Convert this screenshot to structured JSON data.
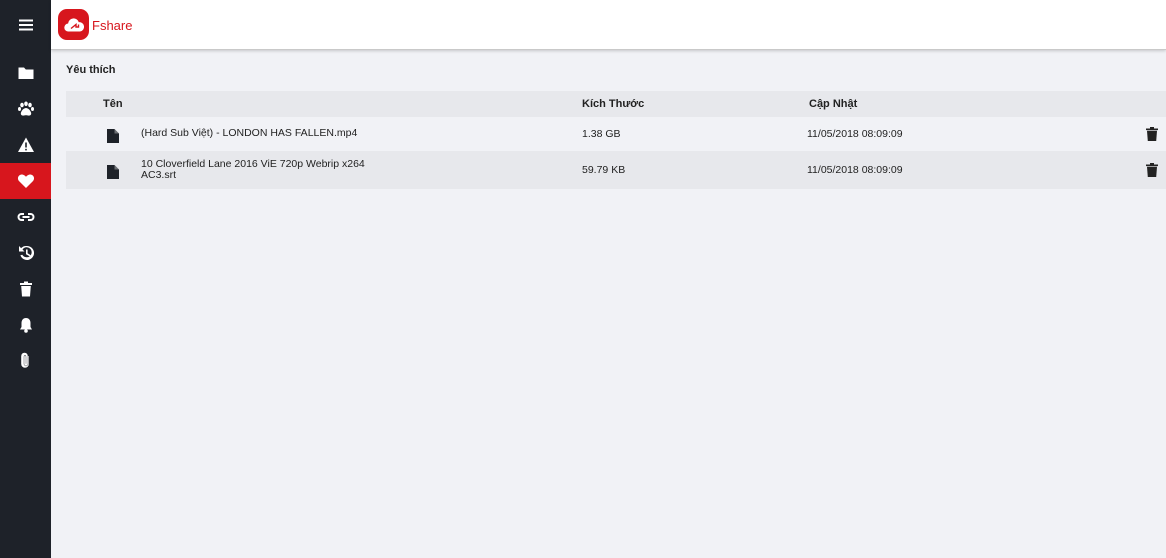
{
  "header": {
    "brand": "Fshare"
  },
  "sidebar": {
    "items": [
      {
        "icon": "menu-icon",
        "active": false
      },
      {
        "icon": "folder-icon",
        "active": false
      },
      {
        "icon": "paw-icon",
        "active": false
      },
      {
        "icon": "warning-icon",
        "active": false
      },
      {
        "icon": "heart-icon",
        "active": true
      },
      {
        "icon": "link-icon",
        "active": false
      },
      {
        "icon": "history-icon",
        "active": false
      },
      {
        "icon": "trash-icon",
        "active": false
      },
      {
        "icon": "bell-icon",
        "active": false
      },
      {
        "icon": "paperclip-icon",
        "active": false
      }
    ]
  },
  "main": {
    "title": "Yêu thích",
    "columns": {
      "name": "Tên",
      "size": "Kích Thước",
      "updated": "Cập Nhật"
    },
    "rows": [
      {
        "name": "(Hard Sub Việt) - LONDON HAS FALLEN.mp4",
        "size": "1.38 GB",
        "updated": "11/05/2018 08:09:09"
      },
      {
        "name": "10 Cloverfield Lane 2016 ViE 720p Webrip x264 AC3.srt",
        "size": "59.79 KB",
        "updated": "11/05/2018 08:09:09"
      }
    ]
  },
  "colors": {
    "brand": "#d7161d",
    "sidebar": "#1e2229",
    "background": "#f1f2f6"
  }
}
